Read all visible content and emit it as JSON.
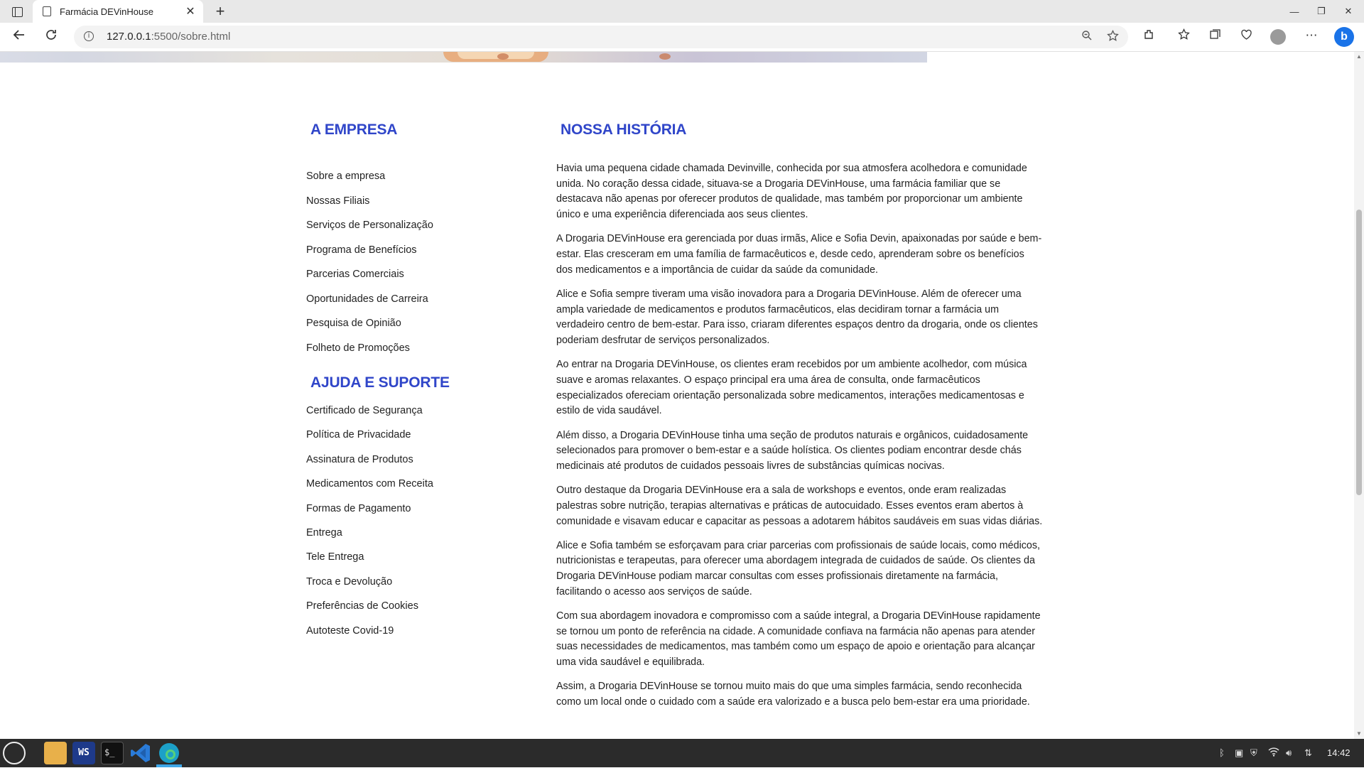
{
  "browser": {
    "tab_title": "Farmácia DEVinHouse",
    "url_host": "127.0.0.1",
    "url_path": ":5500/sobre.html"
  },
  "sidebar": {
    "heading_empresa": "A EMPRESA",
    "empresa_links": [
      "Sobre a empresa",
      "Nossas Filiais",
      "Serviços de Personalização",
      "Programa de Benefícios",
      "Parcerias Comerciais",
      "Oportunidades de Carreira",
      "Pesquisa de Opinião",
      "Folheto de Promoções"
    ],
    "heading_suporte": "AJUDA E SUPORTE",
    "suporte_links": [
      "Certificado de Segurança",
      "Política de Privacidade",
      "Assinatura de Produtos",
      "Medicamentos com Receita",
      "Formas de Pagamento",
      "Entrega",
      "Tele Entrega",
      "Troca e Devolução",
      "Preferências de Cookies",
      "Autoteste Covid-19"
    ]
  },
  "main": {
    "heading": "NOSSA HISTÓRIA",
    "paragraphs": [
      "Havia uma pequena cidade chamada Devinville, conhecida por sua atmosfera acolhedora e comunidade unida. No coração dessa cidade, situava-se a Drogaria DEVinHouse, uma farmácia familiar que se destacava não apenas por oferecer produtos de qualidade, mas também por proporcionar um ambiente único e uma experiência diferenciada aos seus clientes.",
      "A Drogaria DEVinHouse era gerenciada por duas irmãs, Alice e Sofia Devin, apaixonadas por saúde e bem-estar. Elas cresceram em uma família de farmacêuticos e, desde cedo, aprenderam sobre os benefícios dos medicamentos e a importância de cuidar da saúde da comunidade.",
      "Alice e Sofia sempre tiveram uma visão inovadora para a Drogaria DEVinHouse. Além de oferecer uma ampla variedade de medicamentos e produtos farmacêuticos, elas decidiram tornar a farmácia um verdadeiro centro de bem-estar. Para isso, criaram diferentes espaços dentro da drogaria, onde os clientes poderiam desfrutar de serviços personalizados.",
      "Ao entrar na Drogaria DEVinHouse, os clientes eram recebidos por um ambiente acolhedor, com música suave e aromas relaxantes. O espaço principal era uma área de consulta, onde farmacêuticos especializados ofereciam orientação personalizada sobre medicamentos, interações medicamentosas e estilo de vida saudável.",
      "Além disso, a Drogaria DEVinHouse tinha uma seção de produtos naturais e orgânicos, cuidadosamente selecionados para promover o bem-estar e a saúde holística. Os clientes podiam encontrar desde chás medicinais até produtos de cuidados pessoais livres de substâncias químicas nocivas.",
      "Outro destaque da Drogaria DEVinHouse era a sala de workshops e eventos, onde eram realizadas palestras sobre nutrição, terapias alternativas e práticas de autocuidado. Esses eventos eram abertos à comunidade e visavam educar e capacitar as pessoas a adotarem hábitos saudáveis em suas vidas diárias.",
      "Alice e Sofia também se esforçavam para criar parcerias com profissionais de saúde locais, como médicos, nutricionistas e terapeutas, para oferecer uma abordagem integrada de cuidados de saúde. Os clientes da Drogaria DEVinHouse podiam marcar consultas com esses profissionais diretamente na farmácia, facilitando o acesso aos serviços de saúde.",
      "Com sua abordagem inovadora e compromisso com a saúde integral, a Drogaria DEVinHouse rapidamente se tornou um ponto de referência na cidade. A comunidade confiava na farmácia não apenas para atender suas necessidades de medicamentos, mas também como um espaço de apoio e orientação para alcançar uma vida saudável e equilibrada.",
      "Assim, a Drogaria DEVinHouse se tornou muito mais do que uma simples farmácia, sendo reconhecida como um local onde o cuidado com a saúde era valorizado e a busca pelo bem-estar era uma prioridade."
    ]
  },
  "taskbar": {
    "clock": "14:42"
  },
  "colors": {
    "heading_blue": "#3046c9"
  }
}
